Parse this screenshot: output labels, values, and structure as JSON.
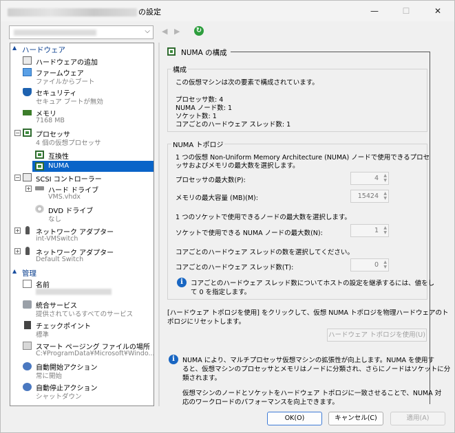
{
  "window": {
    "title_suffix": "の設定",
    "min_icon": "—",
    "max_icon": "☐",
    "close_icon": "✕"
  },
  "toolbar": {
    "back_icon": "◀",
    "fwd_icon": "▶",
    "dropdown_arrow": "⌵",
    "refresh_icon": "↻"
  },
  "tree": {
    "hardware_label": "ハードウェア",
    "management_label": "管理",
    "items": {
      "add_hw": {
        "title": "ハードウェアの追加"
      },
      "firmware": {
        "title": "ファームウェア",
        "sub": "ファイルからブート"
      },
      "security": {
        "title": "セキュリティ",
        "sub": "セキュア ブートが無効"
      },
      "memory": {
        "title": "メモリ",
        "sub": "7168 MB"
      },
      "processor": {
        "title": "プロセッサ",
        "sub": "4 個の仮想プロセッサ"
      },
      "compat": {
        "title": "互換性"
      },
      "numa": {
        "title": "NUMA"
      },
      "scsi": {
        "title": "SCSI コントローラー"
      },
      "hdd": {
        "title": "ハード ドライブ",
        "sub": "VMS.vhdx"
      },
      "dvd": {
        "title": "DVD ドライブ",
        "sub": "なし"
      },
      "net1": {
        "title": "ネットワーク アダプター",
        "sub": "int-VMSwitch"
      },
      "net2": {
        "title": "ネットワーク アダプター",
        "sub": "Default Switch"
      },
      "name": {
        "title": "名前"
      },
      "services": {
        "title": "統合サービス",
        "sub": "提供されているすべてのサービス"
      },
      "checkpoint": {
        "title": "チェックポイント",
        "sub": "標準"
      },
      "paging": {
        "title": "スマート ページング ファイルの場所",
        "sub": "C:¥ProgramData¥Microsoft¥Windo..."
      },
      "autostart": {
        "title": "自動開始アクション",
        "sub": "常に開始"
      },
      "autostop": {
        "title": "自動停止アクション",
        "sub": "シャットダウン"
      }
    }
  },
  "panel": {
    "title": "NUMA の構成",
    "config": {
      "group_title": "構成",
      "intro": "この仮想マシンは次の要素で構成されています。",
      "processors": "プロセッサ数: 4",
      "numa_nodes": "NUMA ノード数: 1",
      "sockets": "ソケット数: 1",
      "threads": "コアごとのハードウェア スレッド数: 1"
    },
    "topology": {
      "group_title": "NUMA トポロジ",
      "desc1": "1 つの仮想 Non-Uniform Memory Architecture (NUMA) ノードで使用できるプロセ",
      "desc2": "ッサおよびメモリの最大数を選択します。",
      "max_proc_label": "プロセッサの最大数(P):",
      "max_proc_value": "4",
      "max_mem_label": "メモリの最大容量 (MB)(M):",
      "max_mem_value": "15424",
      "socket_desc": "1 つのソケットで使用できるノードの最大数を選択します。",
      "max_nodes_label": "ソケットで使用できる NUMA ノードの最大数(N):",
      "max_nodes_value": "1",
      "thread_desc": "コアごとのハードウェア スレッドの数を選択してください。",
      "thread_label": "コアごとのハードウェア スレッド数(T):",
      "thread_value": "0",
      "info1": "コアごとのハードウェア スレッド数についてホストの設定を継承するには、値をし",
      "info2": "て 0 を指定します。"
    },
    "reset_desc1": "[ハードウェア トポロジを使用] をクリックして、仮想 NUMA トポロジを物理ハードウェアのト",
    "reset_desc2": "ポロジにリセットします。",
    "use_hw_button": "ハードウェア トポロジを使用(U)",
    "note1": "NUMA により、マルチプロセッサ仮想マシンの拡張性が向上します。NUMA を使用す",
    "note2": "ると、仮想マシンのプロセッサとメモリはノードに分類され、さらにノードはソケットに分",
    "note3": "類されます。",
    "note4": "仮想マシンのノードとソケットをハードウェア トポロジに一致させることで、NUMA 対",
    "note5": "応のワークロードのパフォーマンスを向上できます。"
  },
  "buttons": {
    "ok": "OK(O)",
    "cancel": "キャンセル(C)",
    "apply": "適用(A)"
  }
}
